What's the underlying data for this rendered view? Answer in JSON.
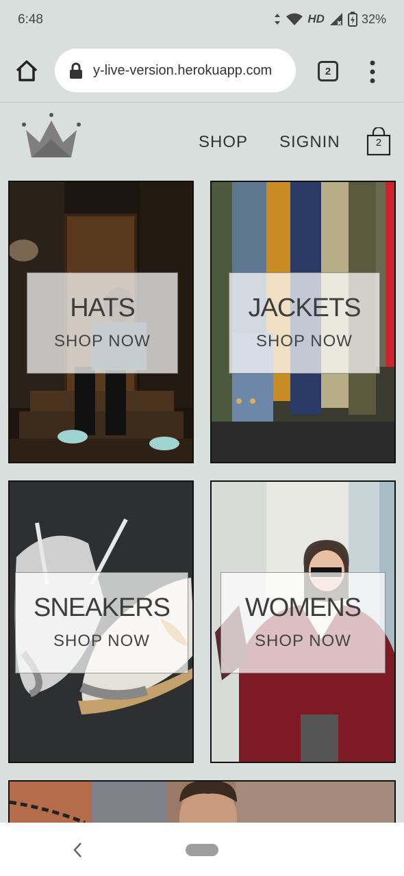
{
  "status": {
    "time": "6:48",
    "network": "HD",
    "battery": "32%"
  },
  "browser": {
    "url": "y-live-version.herokuapp.com",
    "tab_count": "2"
  },
  "header": {
    "nav": [
      {
        "label": "SHOP"
      },
      {
        "label": "SIGNIN"
      }
    ],
    "cart_count": "2"
  },
  "categories": [
    {
      "title": "HATS",
      "cta": "SHOP NOW"
    },
    {
      "title": "JACKETS",
      "cta": "SHOP NOW"
    },
    {
      "title": "SNEAKERS",
      "cta": "SHOP NOW"
    },
    {
      "title": "WOMENS",
      "cta": "SHOP NOW"
    }
  ],
  "colors": {
    "page_bg": "#d9dfdd",
    "label_bg": "rgba(255,255,255,0.72)",
    "text": "#3d3d3d"
  }
}
